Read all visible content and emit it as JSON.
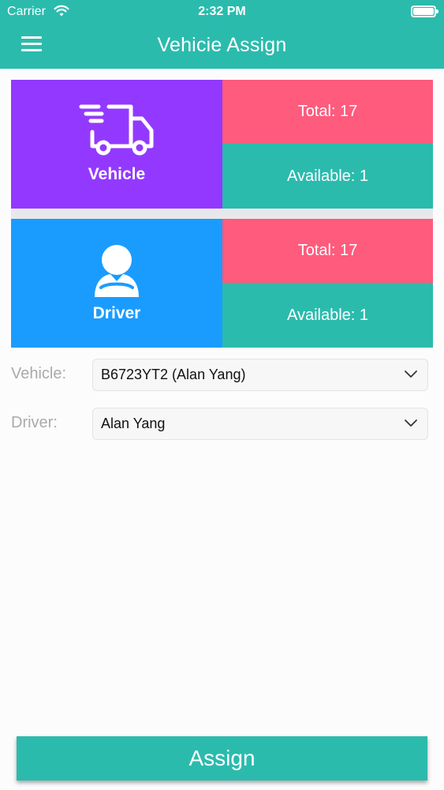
{
  "status_bar": {
    "carrier": "Carrier",
    "time": "2:32 PM"
  },
  "header": {
    "title": "Vehicie Assign",
    "menu_icon": "hamburger-menu-icon"
  },
  "vehicle_card": {
    "label": "Vehicle",
    "icon": "delivery-truck-icon",
    "total": "Total: 17",
    "available": "Available: 1",
    "colors": {
      "main": "#9339ff",
      "total": "#ff5b7d",
      "available": "#2bbbad"
    }
  },
  "driver_card": {
    "label": "Driver",
    "icon": "driver-icon",
    "total": "Total: 17",
    "available": "Available: 1",
    "colors": {
      "main": "#1a9cff",
      "total": "#ff5b7d",
      "available": "#2bbbad"
    }
  },
  "form": {
    "vehicle_label": "Vehicle:",
    "vehicle_value": "B6723YT2 (Alan Yang)",
    "driver_label": "Driver:",
    "driver_value": "Alan Yang"
  },
  "actions": {
    "assign_label": "Assign"
  },
  "theme": {
    "accent": "#2bbbad"
  }
}
